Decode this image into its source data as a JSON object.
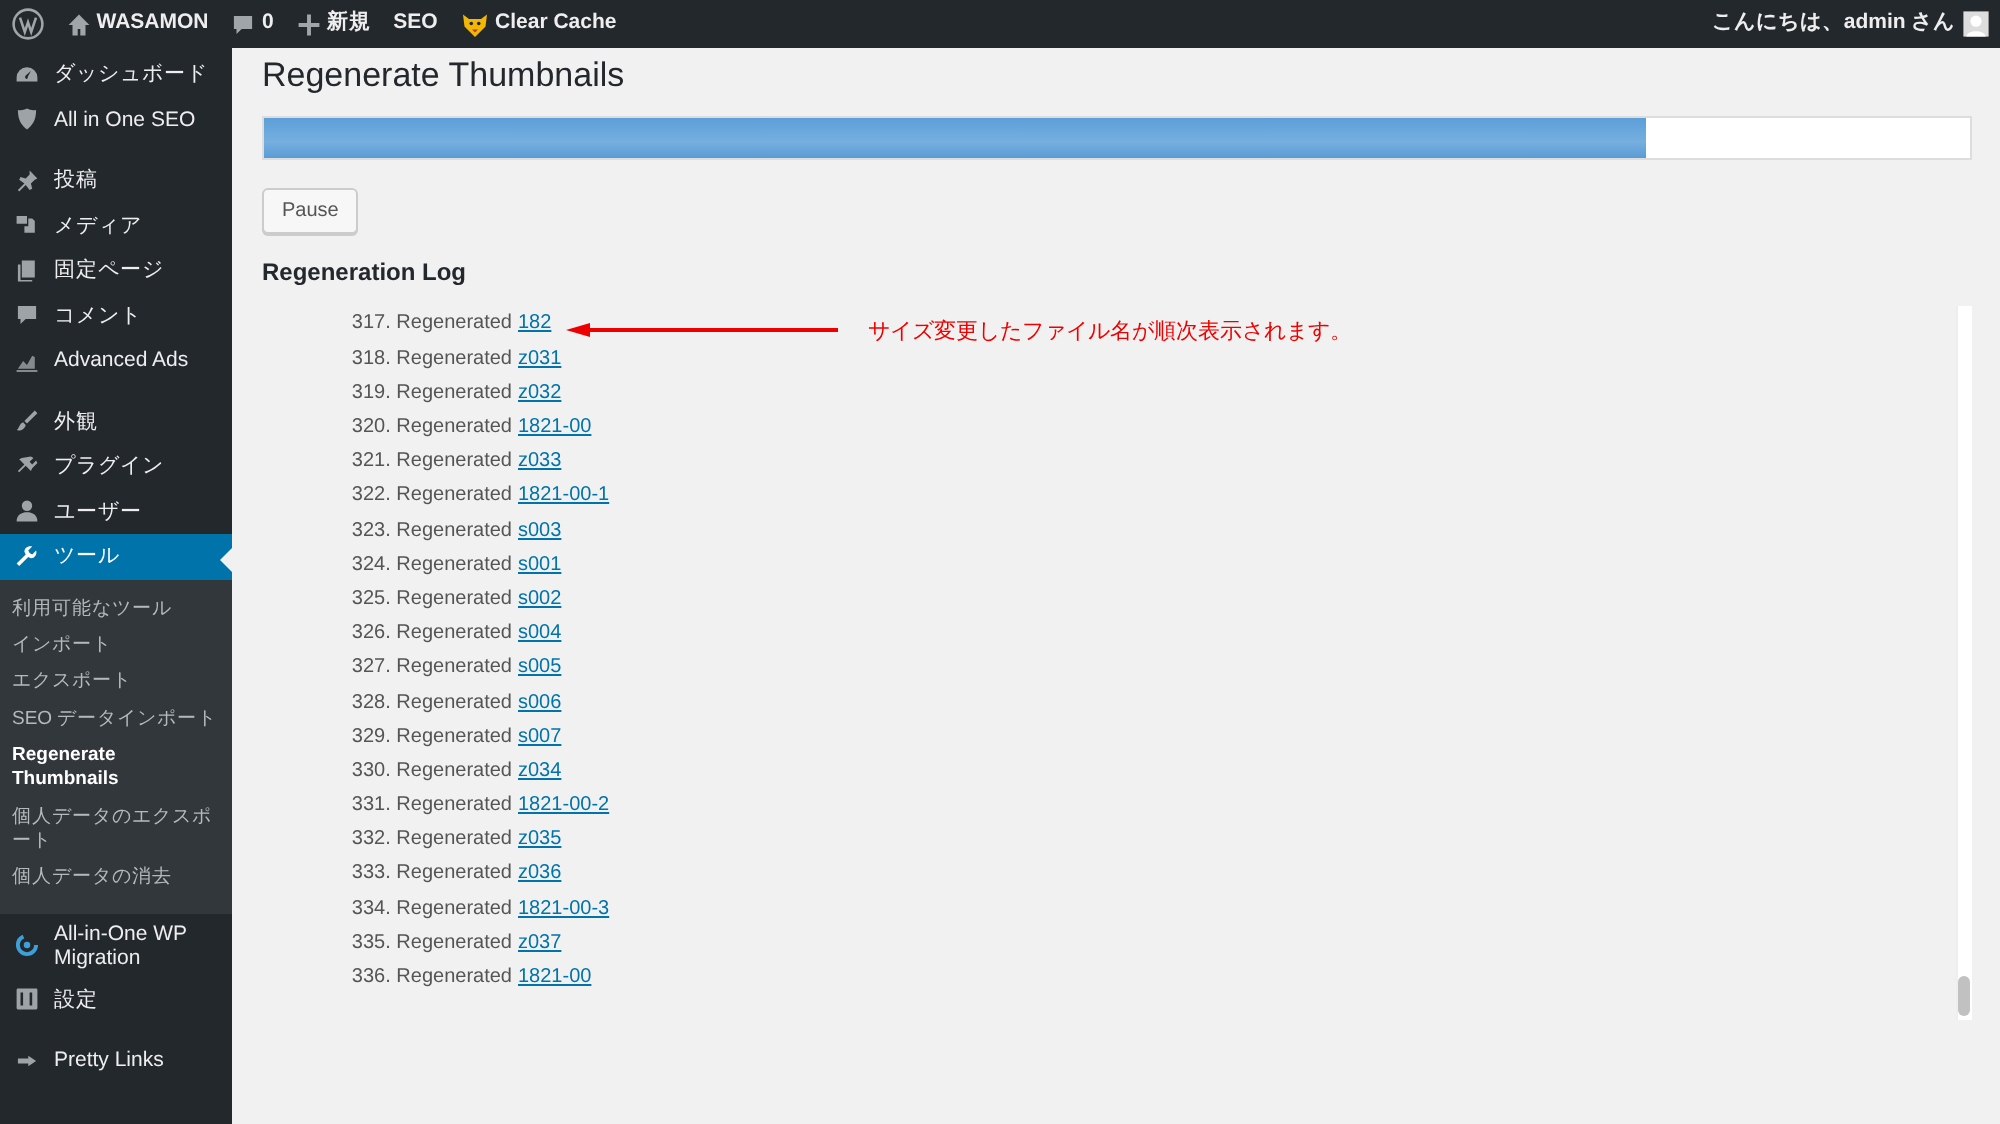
{
  "admin_bar": {
    "site": "WASAMON",
    "comments": "0",
    "new": "新規",
    "seo": "SEO",
    "cache": "Clear Cache",
    "greeting": "こんにちは、admin さん"
  },
  "sidebar": {
    "groups": [
      {
        "items": [
          {
            "label": "ダッシュボード",
            "selected": false
          },
          {
            "label": "All in One SEO",
            "selected": false
          }
        ]
      },
      {
        "items": [
          {
            "label": "投稿",
            "selected": false
          },
          {
            "label": "メディア",
            "selected": false
          },
          {
            "label": "固定ページ",
            "selected": false
          },
          {
            "label": "コメント",
            "selected": false
          },
          {
            "label": "Advanced Ads",
            "selected": false
          }
        ]
      },
      {
        "items": [
          {
            "label": "外観",
            "selected": false
          },
          {
            "label": "プラグイン",
            "selected": false
          },
          {
            "label": "ユーザー",
            "selected": false
          },
          {
            "label": "ツール",
            "selected": true,
            "submenu": [
              {
                "label": "利用可能なツール",
                "selected": false
              },
              {
                "label": "インポート",
                "selected": false
              },
              {
                "label": "エクスポート",
                "selected": false
              },
              {
                "label": "SEO データインポート",
                "selected": false
              },
              {
                "label": "Regenerate Thumbnails",
                "selected": true
              },
              {
                "label": "個人データのエクスポート",
                "selected": false
              },
              {
                "label": "個人データの消去",
                "selected": false
              }
            ]
          },
          {
            "label": "All-in-One WP Migration",
            "selected": false
          },
          {
            "label": "設定",
            "selected": false
          }
        ]
      },
      {
        "items": [
          {
            "label": "Pretty Links",
            "selected": false
          }
        ]
      }
    ]
  },
  "page": {
    "title": "Regenerate Thumbnails",
    "progress": {
      "level": 0.81
    },
    "pause_button": "Pause",
    "log_heading": "Regeneration Log",
    "log": [
      {
        "text": "317. Regenerated",
        "file": "182"
      },
      {
        "text": "318. Regenerated",
        "file": "z031"
      },
      {
        "text": "319. Regenerated",
        "file": "z032"
      },
      {
        "text": "320. Regenerated",
        "file": "1821-00"
      },
      {
        "text": "321. Regenerated",
        "file": "z033"
      },
      {
        "text": "322. Regenerated",
        "file": "1821-00-1"
      },
      {
        "text": "323. Regenerated",
        "file": "s003"
      },
      {
        "text": "324. Regenerated",
        "file": "s001"
      },
      {
        "text": "325. Regenerated",
        "file": "s002"
      },
      {
        "text": "326. Regenerated",
        "file": "s004"
      },
      {
        "text": "327. Regenerated",
        "file": "s005"
      },
      {
        "text": "328. Regenerated",
        "file": "s006"
      },
      {
        "text": "329. Regenerated",
        "file": "s007"
      },
      {
        "text": "330. Regenerated",
        "file": "z034"
      },
      {
        "text": "331. Regenerated",
        "file": "1821-00-2"
      },
      {
        "text": "332. Regenerated",
        "file": "z035"
      },
      {
        "text": "333. Regenerated",
        "file": "z036"
      },
      {
        "text": "334. Regenerated",
        "file": "1821-00-3"
      },
      {
        "text": "335. Regenerated",
        "file": "z037"
      },
      {
        "text": "336. Regenerated",
        "file": "1821-00"
      }
    ],
    "annotation": "サイズ変更したファイル名が順次表示されます。"
  }
}
